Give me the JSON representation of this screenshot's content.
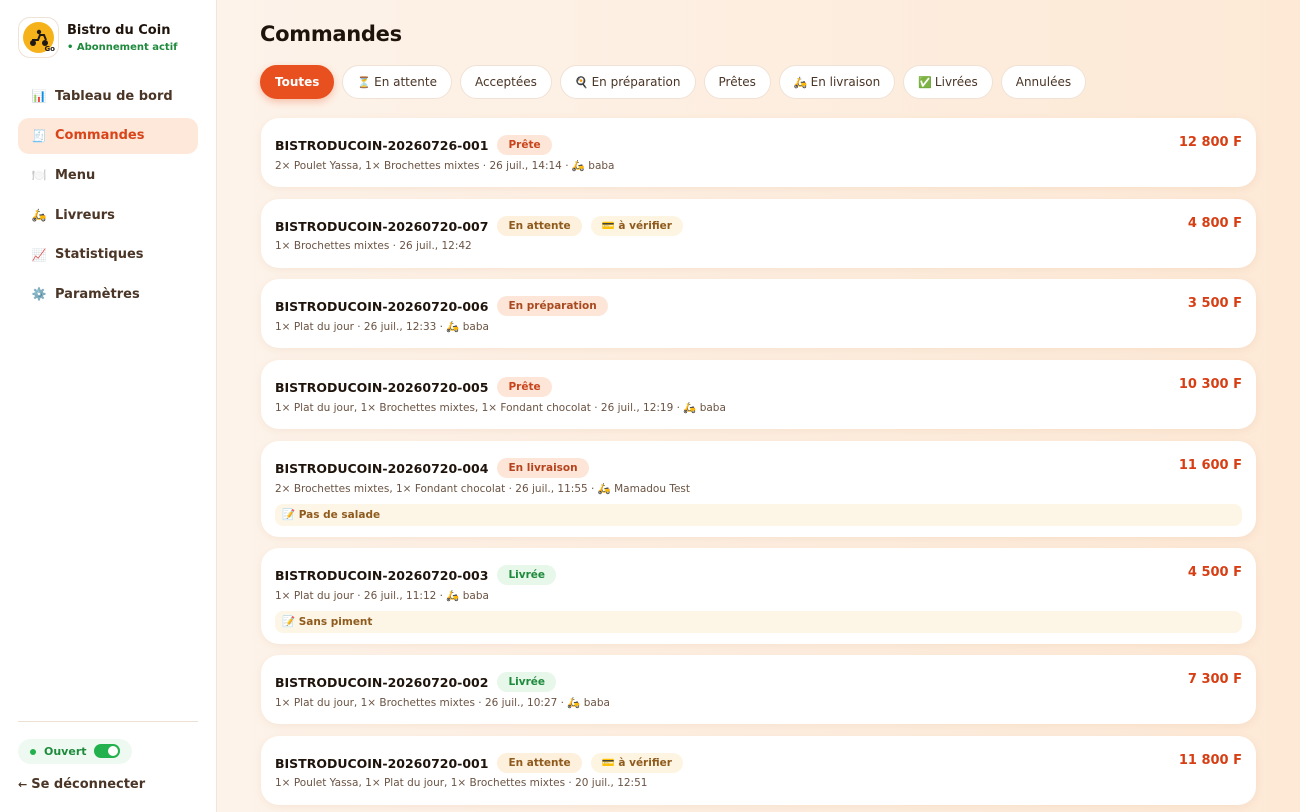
{
  "brand": {
    "name": "Bistro du Coin",
    "subscription": "• Abonnement actif",
    "logo_text": "Go"
  },
  "nav": [
    {
      "icon": "📊",
      "label": "Tableau de bord"
    },
    {
      "icon": "🧾",
      "label": "Commandes"
    },
    {
      "icon": "🍽️",
      "label": "Menu"
    },
    {
      "icon": "🛵",
      "label": "Livreurs"
    },
    {
      "icon": "📈",
      "label": "Statistiques"
    },
    {
      "icon": "⚙️",
      "label": "Paramètres"
    }
  ],
  "status": {
    "label": "Ouvert",
    "open": true
  },
  "logout": {
    "arrow": "←",
    "label": "Se déconnecter"
  },
  "page": {
    "title": "Commandes"
  },
  "tabs": [
    {
      "icon": "",
      "label": "Toutes"
    },
    {
      "icon": "⏳",
      "label": "En attente"
    },
    {
      "icon": "",
      "label": "Acceptées"
    },
    {
      "icon": "🍳",
      "label": "En préparation"
    },
    {
      "icon": "",
      "label": "Prêtes"
    },
    {
      "icon": "🛵",
      "label": "En livraison"
    },
    {
      "icon": "✅",
      "label": "Livrées"
    },
    {
      "icon": "",
      "label": "Annulées"
    }
  ],
  "orders": [
    {
      "id": "BISTRODUCOIN-20260726-001",
      "status": "Prête",
      "payment": "",
      "desc": "2× Poulet Yassa, 1× Brochettes mixtes · 26 juil., 14:14 · 🛵 baba",
      "note": "",
      "amount": "12 800 F"
    },
    {
      "id": "BISTRODUCOIN-20260720-007",
      "status": "En attente",
      "payment": "💳 à vérifier",
      "desc": "1× Brochettes mixtes · 26 juil., 12:42",
      "note": "",
      "amount": "4 800 F"
    },
    {
      "id": "BISTRODUCOIN-20260720-006",
      "status": "En préparation",
      "payment": "",
      "desc": "1× Plat du jour · 26 juil., 12:33 · 🛵 baba",
      "note": "",
      "amount": "3 500 F"
    },
    {
      "id": "BISTRODUCOIN-20260720-005",
      "status": "Prête",
      "payment": "",
      "desc": "1× Plat du jour, 1× Brochettes mixtes, 1× Fondant chocolat · 26 juil., 12:19 · 🛵 baba",
      "note": "",
      "amount": "10 300 F"
    },
    {
      "id": "BISTRODUCOIN-20260720-004",
      "status": "En livraison",
      "payment": "",
      "desc": "2× Brochettes mixtes, 1× Fondant chocolat · 26 juil., 11:55 · 🛵 Mamadou Test",
      "note": "📝 Pas de salade",
      "amount": "11 600 F"
    },
    {
      "id": "BISTRODUCOIN-20260720-003",
      "status": "Livrée",
      "payment": "",
      "desc": "1× Plat du jour · 26 juil., 11:12 · 🛵 baba",
      "note": "📝 Sans piment",
      "amount": "4 500 F"
    },
    {
      "id": "BISTRODUCOIN-20260720-002",
      "status": "Livrée",
      "payment": "",
      "desc": "1× Plat du jour, 1× Brochettes mixtes · 26 juil., 10:27 · 🛵 baba",
      "note": "",
      "amount": "7 300 F"
    },
    {
      "id": "BISTRODUCOIN-20260720-001",
      "status": "En attente",
      "payment": "💳 à vérifier",
      "desc": "1× Poulet Yassa, 1× Plat du jour, 1× Brochettes mixtes · 20 juil., 12:51",
      "note": "",
      "amount": "11 800 F"
    }
  ]
}
